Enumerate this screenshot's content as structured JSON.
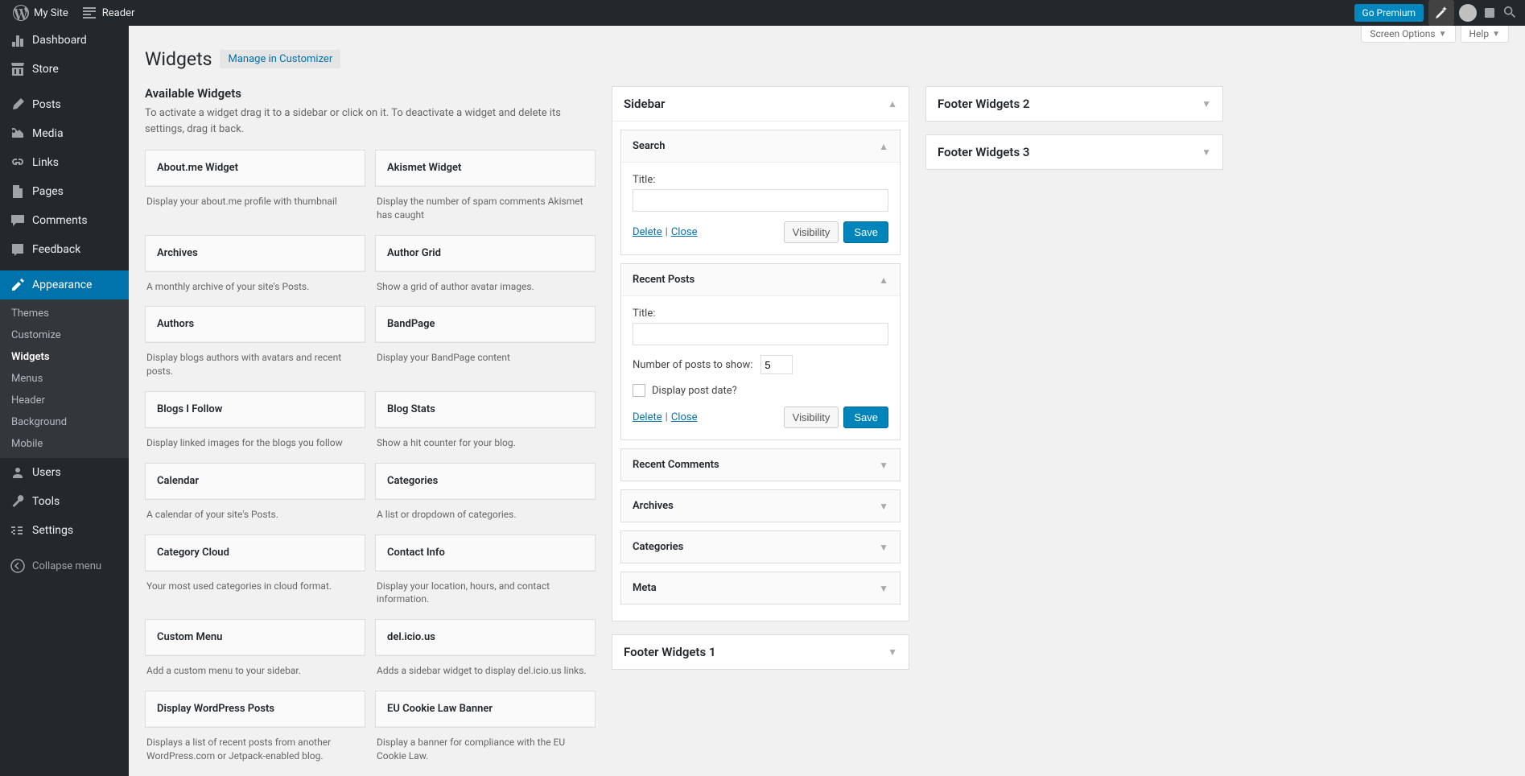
{
  "adminBar": {
    "mySite": "My Site",
    "reader": "Reader",
    "goPremium": "Go Premium"
  },
  "sidebar": {
    "items": [
      {
        "icon": "dashboard",
        "label": "Dashboard"
      },
      {
        "icon": "store",
        "label": "Store"
      },
      {
        "icon": "posts",
        "label": "Posts"
      },
      {
        "icon": "media",
        "label": "Media"
      },
      {
        "icon": "links",
        "label": "Links"
      },
      {
        "icon": "pages",
        "label": "Pages"
      },
      {
        "icon": "comments",
        "label": "Comments"
      },
      {
        "icon": "feedback",
        "label": "Feedback"
      },
      {
        "icon": "appearance",
        "label": "Appearance"
      },
      {
        "icon": "users",
        "label": "Users"
      },
      {
        "icon": "tools",
        "label": "Tools"
      },
      {
        "icon": "settings",
        "label": "Settings"
      }
    ],
    "submenu": [
      "Themes",
      "Customize",
      "Widgets",
      "Menus",
      "Header",
      "Background",
      "Mobile"
    ],
    "collapse": "Collapse menu"
  },
  "screenOptions": "Screen Options",
  "help": "Help",
  "page": {
    "title": "Widgets",
    "customizerBtn": "Manage in Customizer",
    "availableTitle": "Available Widgets",
    "availableDesc": "To activate a widget drag it to a sidebar or click on it. To deactivate a widget and delete its settings, drag it back."
  },
  "availableWidgets": [
    {
      "name": "About.me Widget",
      "desc": "Display your about.me profile with thumbnail"
    },
    {
      "name": "Akismet Widget",
      "desc": "Display the number of spam comments Akismet has caught"
    },
    {
      "name": "Archives",
      "desc": "A monthly archive of your site's Posts."
    },
    {
      "name": "Author Grid",
      "desc": "Show a grid of author avatar images."
    },
    {
      "name": "Authors",
      "desc": "Display blogs authors with avatars and recent posts."
    },
    {
      "name": "BandPage",
      "desc": "Display your BandPage content"
    },
    {
      "name": "Blogs I Follow",
      "desc": "Display linked images for the blogs you follow"
    },
    {
      "name": "Blog Stats",
      "desc": "Show a hit counter for your blog."
    },
    {
      "name": "Calendar",
      "desc": "A calendar of your site's Posts."
    },
    {
      "name": "Categories",
      "desc": "A list or dropdown of categories."
    },
    {
      "name": "Category Cloud",
      "desc": "Your most used categories in cloud format."
    },
    {
      "name": "Contact Info",
      "desc": "Display your location, hours, and contact information."
    },
    {
      "name": "Custom Menu",
      "desc": "Add a custom menu to your sidebar."
    },
    {
      "name": "del.icio.us",
      "desc": "Adds a sidebar widget to display del.icio.us links."
    },
    {
      "name": "Display WordPress Posts",
      "desc": "Displays a list of recent posts from another WordPress.com or Jetpack-enabled blog."
    },
    {
      "name": "EU Cookie Law Banner",
      "desc": "Display a banner for compliance with the EU Cookie Law."
    }
  ],
  "areas": {
    "sidebarArea": {
      "title": "Sidebar",
      "widgets": {
        "search": {
          "title": "Search",
          "titleLabel": "Title:",
          "titleValue": "",
          "delete": "Delete",
          "close": "Close",
          "visibility": "Visibility",
          "save": "Save"
        },
        "recentPosts": {
          "title": "Recent Posts",
          "titleLabel": "Title:",
          "titleValue": "",
          "numPostsLabel": "Number of posts to show:",
          "numPostsValue": "5",
          "displayDateLabel": "Display post date?",
          "delete": "Delete",
          "close": "Close",
          "visibility": "Visibility",
          "save": "Save"
        },
        "collapsed": [
          "Recent Comments",
          "Archives",
          "Categories",
          "Meta"
        ]
      }
    },
    "footer1": "Footer Widgets 1",
    "footer2": "Footer Widgets 2",
    "footer3": "Footer Widgets 3"
  }
}
